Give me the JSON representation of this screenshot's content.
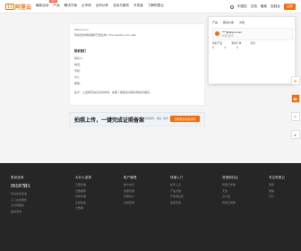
{
  "header": {
    "logo_text": "阿里云",
    "nav": [
      "最新活动",
      "产品",
      "解决方案",
      "云市场",
      "合作伙伴",
      "支持与服务",
      "开发者",
      "了解阿里云"
    ],
    "new_badge": "NEW",
    "right": [
      "中国站",
      "文档",
      "备案",
      "控制台",
      "注册"
    ]
  },
  "main": {
    "welcome": "Welcome to",
    "domain_text": "恭喜您的域名解析已经生效 / The website is for sale!",
    "section_title": "联系我们",
    "rows": [
      "联系人：",
      "电话：",
      "手机：",
      "QQ：",
      "邮箱："
    ],
    "note": "提示：上述网页信息仅供参考，如需了解更多请联系网站管理员。"
  },
  "popup": {
    "tabs": [
      "产品",
      "解决方案",
      "文档"
    ],
    "user": "****@aliyun.com",
    "user_sub": "阿里云账号",
    "links": [
      "我的产品",
      "我的订单",
      "消息"
    ],
    "values": [
      "0",
      "0",
      "0"
    ]
  },
  "banner": {
    "title": "拍照上传，一键完成证照备案",
    "middle": "阿里云ICP备案服务 · 快速 · 便捷",
    "button": "查看更多备案详情"
  },
  "footer": {
    "contact": {
      "head": "售前咨询",
      "phone": "95187转1",
      "items": [
        "售后在线咨询",
        "人工在线服务",
        "云市场服务",
        "备案咨询"
      ]
    },
    "columns": [
      {
        "head": "为什么选择",
        "items": [
          "云服务器",
          "云数据库",
          "对象存储",
          "全球加速",
          "大数据"
        ]
      },
      {
        "head": "账户管理",
        "items": [
          "账户充值",
          "发票管理",
          "管理中心",
          "余额查询"
        ]
      },
      {
        "head": "快速入门",
        "items": [
          "新手上云",
          "产品文档",
          "开发者社区",
          "最佳实践"
        ]
      },
      {
        "head": "资源和社区",
        "items": [
          "阿里云学堂",
          "天池",
          "云大会",
          "阿里云博客"
        ]
      },
      {
        "head": "关注阿里云",
        "items": [
          "微博",
          "微信",
          "钉钉"
        ]
      }
    ]
  },
  "side_tools": [
    "chat-icon",
    "phone-icon",
    "feedback-icon",
    "top-icon"
  ],
  "colors": {
    "accent": "#ff6a00",
    "footer_bg": "#262626"
  }
}
